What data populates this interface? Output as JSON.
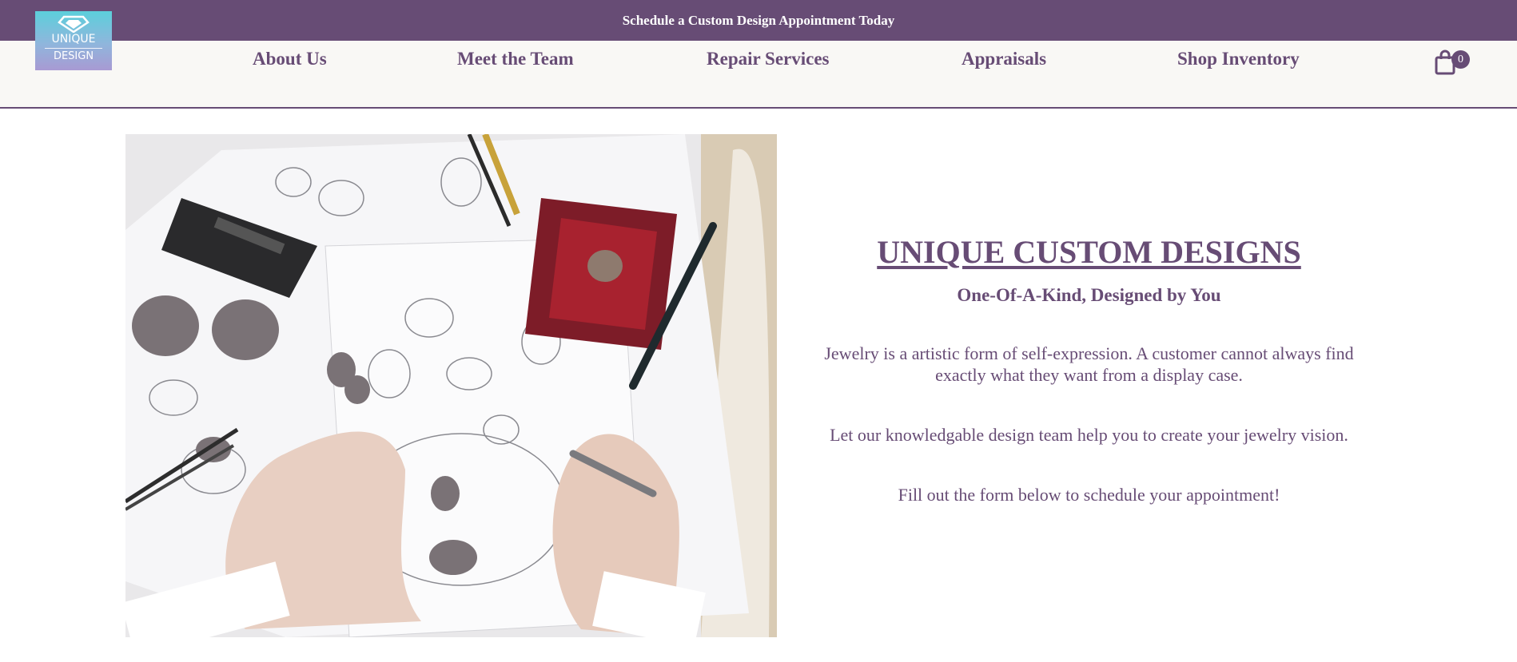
{
  "announcement": {
    "text": "Schedule a Custom Design Appointment Today"
  },
  "logo": {
    "line1": "UNIQUE",
    "line2": "DESIGN",
    "icon": "diamond-icon",
    "gradient": [
      "#5ccfdb",
      "#a89ad3"
    ]
  },
  "nav": {
    "items": [
      {
        "label": "About Us"
      },
      {
        "label": "Meet the Team"
      },
      {
        "label": "Repair Services"
      },
      {
        "label": "Appraisals"
      },
      {
        "label": "Shop Inventory"
      }
    ]
  },
  "cart": {
    "icon": "shopping-bag-icon",
    "count": "0"
  },
  "hero": {
    "image_description_icon": "jewelry-sketch-image",
    "title": "UNIQUE CUSTOM DESIGNS",
    "subtitle": "One-Of-A-Kind, Designed by You",
    "paragraph1": "Jewelry is a artistic form of self-expression. A customer cannot always find exactly what they want from a display case.",
    "paragraph2": "Let our knowledgable design team help you to create your jewelry vision.",
    "paragraph3": "Fill out the form below to schedule your appointment!"
  },
  "colors": {
    "brand": "#674c75",
    "header_bg": "#f9f8f5",
    "text": "#674c75"
  }
}
